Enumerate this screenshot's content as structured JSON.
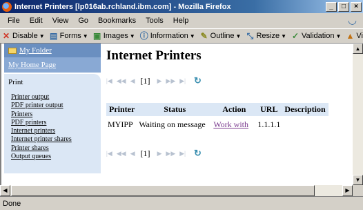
{
  "window": {
    "title": "Internet Printers [lp016ab.rchland.ibm.com] - Mozilla Firefox",
    "buttons": [
      "_",
      "□",
      "×"
    ]
  },
  "menubar": {
    "items": [
      {
        "label": "File",
        "key": "F"
      },
      {
        "label": "Edit",
        "key": "E"
      },
      {
        "label": "View",
        "key": "V"
      },
      {
        "label": "Go",
        "key": "G"
      },
      {
        "label": "Bookmarks",
        "key": "B"
      },
      {
        "label": "Tools",
        "key": "T"
      },
      {
        "label": "Help",
        "key": "H"
      }
    ]
  },
  "toolbar": {
    "items": [
      {
        "label": "Disable",
        "icon": "x-icon"
      },
      {
        "label": "Forms",
        "icon": "forms-icon"
      },
      {
        "label": "Images",
        "icon": "images-icon"
      },
      {
        "label": "Information",
        "icon": "info-icon"
      },
      {
        "label": "Outline",
        "icon": "pencil-icon"
      },
      {
        "label": "Resize",
        "icon": "resize-icon"
      },
      {
        "label": "Validation",
        "icon": "check-icon"
      },
      {
        "label": "View",
        "icon": "view-icon"
      }
    ]
  },
  "nav": {
    "folder_label": "My Folder",
    "home_label": "My Home Page",
    "section_label": "Print",
    "links": [
      "Printer output",
      "PDF printer output",
      "Printers",
      "PDF printers",
      "Internet printers",
      "Internet printer shares",
      "Printer shares",
      "Output queues"
    ]
  },
  "main": {
    "title": "Internet Printers",
    "page_number": "[1]",
    "columns": [
      "Printer",
      "Status",
      "Action",
      "URL",
      "Description"
    ],
    "rows": [
      {
        "printer": "MYIPP",
        "status": "Waiting on message",
        "action": "Work with",
        "url": "1.1.1.1",
        "description": ""
      }
    ]
  },
  "status": {
    "text": "Done"
  },
  "colors": {
    "title_bar": "#0a246a",
    "nav_dark": "#6a8fc0",
    "nav_light": "#dbe7f5",
    "visited_link": "#7b3b8f"
  }
}
